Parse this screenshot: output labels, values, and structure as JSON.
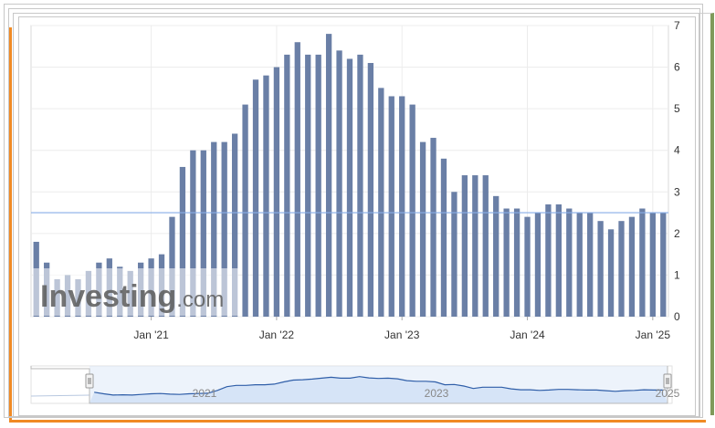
{
  "watermark": {
    "brand": "Investing",
    "suffix": ".com"
  },
  "colors": {
    "bar": "#6a7fa6",
    "refline": "#88aee8",
    "grid": "#ececec",
    "navfill": "#d6e4f7",
    "navline": "#2f5ea8"
  },
  "chart_data": {
    "type": "bar",
    "title": "",
    "xlabel": "",
    "ylabel": "",
    "ylim": [
      0,
      7
    ],
    "y_ticks": [
      "0",
      "1",
      "2",
      "3",
      "4",
      "5",
      "6",
      "7"
    ],
    "x_ticks": [
      "Jan '21",
      "Jan '22",
      "Jan '23",
      "Jan '24",
      "Jan '25"
    ],
    "x_tick_months": [
      "2021-01",
      "2022-01",
      "2023-01",
      "2024-01",
      "2025-01"
    ],
    "reference_line": 2.5,
    "months": [
      "2020-02",
      "2020-03",
      "2020-04",
      "2020-05",
      "2020-06",
      "2020-07",
      "2020-08",
      "2020-09",
      "2020-10",
      "2020-11",
      "2020-12",
      "2021-01",
      "2021-02",
      "2021-03",
      "2021-04",
      "2021-05",
      "2021-06",
      "2021-07",
      "2021-08",
      "2021-09",
      "2021-10",
      "2021-11",
      "2021-12",
      "2022-01",
      "2022-02",
      "2022-03",
      "2022-04",
      "2022-05",
      "2022-06",
      "2022-07",
      "2022-08",
      "2022-09",
      "2022-10",
      "2022-11",
      "2022-12",
      "2023-01",
      "2023-02",
      "2023-03",
      "2023-04",
      "2023-05",
      "2023-06",
      "2023-07",
      "2023-08",
      "2023-09",
      "2023-10",
      "2023-11",
      "2023-12",
      "2024-01",
      "2024-02",
      "2024-03",
      "2024-04",
      "2024-05",
      "2024-06",
      "2024-07",
      "2024-08",
      "2024-09",
      "2024-10",
      "2024-11",
      "2024-12",
      "2025-01",
      "2025-02"
    ],
    "values": [
      1.8,
      1.3,
      0.9,
      1.0,
      0.9,
      1.1,
      1.3,
      1.4,
      1.2,
      1.1,
      1.3,
      1.4,
      1.5,
      2.4,
      3.6,
      4.0,
      4.0,
      4.2,
      4.2,
      4.4,
      5.1,
      5.7,
      5.8,
      6.0,
      6.3,
      6.6,
      6.3,
      6.3,
      6.8,
      6.4,
      6.2,
      6.3,
      6.1,
      5.5,
      5.3,
      5.3,
      5.1,
      4.2,
      4.3,
      3.8,
      3.0,
      3.4,
      3.4,
      3.4,
      2.9,
      2.6,
      2.6,
      2.4,
      2.5,
      2.7,
      2.7,
      2.6,
      2.5,
      2.5,
      2.3,
      2.1,
      2.3,
      2.4,
      2.6,
      2.5,
      2.5
    ],
    "navigator": {
      "labels": [
        "2021",
        "2023",
        "2025"
      ]
    }
  }
}
